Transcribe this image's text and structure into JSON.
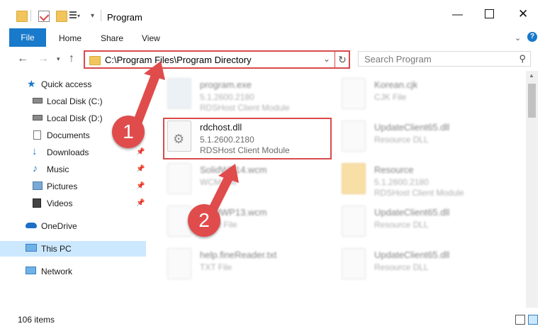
{
  "window": {
    "title": "Program",
    "minimize_icon": "minimize-icon",
    "maximize_icon": "maximize-icon",
    "close_icon": "close-icon"
  },
  "ribbon": {
    "tabs": [
      "File",
      "Home",
      "Share",
      "View"
    ]
  },
  "nav": {
    "address": "C:\\Program Files\\Program Directory",
    "search_placeholder": "Search Program"
  },
  "sidebar": {
    "items": [
      {
        "label": "Quick access",
        "icon": "star-icon"
      },
      {
        "label": "Local Disk (C:)",
        "icon": "drive-icon"
      },
      {
        "label": "Local Disk (D:)",
        "icon": "drive-icon"
      },
      {
        "label": "Documents",
        "icon": "documents-icon"
      },
      {
        "label": "Downloads",
        "icon": "downloads-icon"
      },
      {
        "label": "Music",
        "icon": "music-icon"
      },
      {
        "label": "Pictures",
        "icon": "pictures-icon"
      },
      {
        "label": "Videos",
        "icon": "videos-icon"
      },
      {
        "label": "OneDrive",
        "icon": "cloud-icon"
      },
      {
        "label": "This PC",
        "icon": "computer-icon"
      },
      {
        "label": "Network",
        "icon": "network-icon"
      }
    ]
  },
  "files": {
    "left": [
      {
        "name": "program.exe",
        "meta": "5.1.2600.2180",
        "desc": "RDSHost Client Module"
      },
      {
        "name": "rdchost.dll",
        "meta": "5.1.2600.2180",
        "desc": "RDSHost Client Module"
      },
      {
        "name": "SolidWP14.wcm",
        "meta": "WCM File",
        "desc": ""
      },
      {
        "name": "SolidWP13.wcm",
        "meta": "WCM File",
        "desc": ""
      },
      {
        "name": "help.fineReader.txt",
        "meta": "TXT File",
        "desc": ""
      }
    ],
    "right": [
      {
        "name": "Korean.cjk",
        "meta": "CJK File",
        "desc": ""
      },
      {
        "name": "UpdateClient65.dll",
        "meta": "Resource DLL",
        "desc": ""
      },
      {
        "name": "Resource",
        "meta": "5.1.2600.2180",
        "desc": "RDSHost Client Module"
      },
      {
        "name": "UpdateClient65.dll",
        "meta": "Resource DLL",
        "desc": ""
      },
      {
        "name": "UpdateClient65.dll",
        "meta": "Resource DLL",
        "desc": ""
      }
    ]
  },
  "status": {
    "items_count": "106 items"
  },
  "annotations": {
    "step1": "1",
    "step2": "2",
    "color": "#e04c4c"
  }
}
